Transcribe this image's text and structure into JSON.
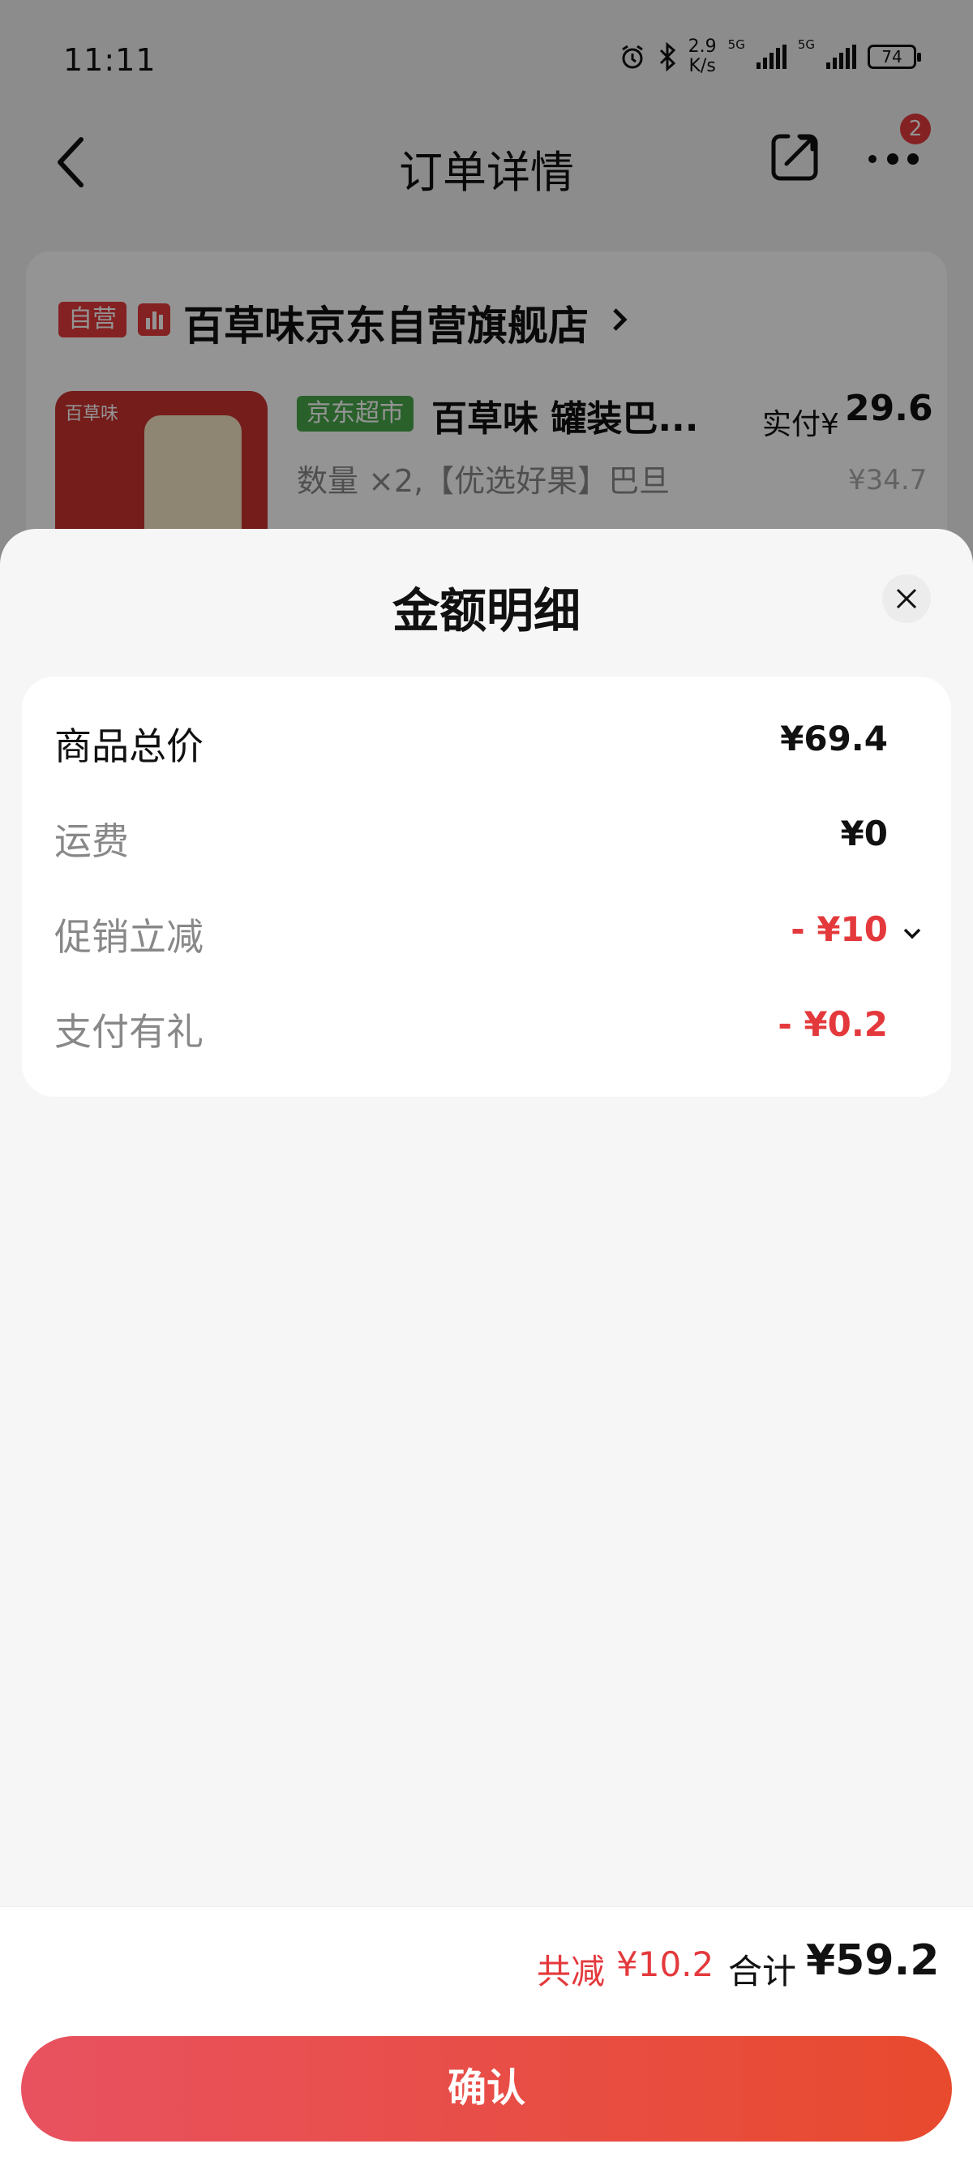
{
  "status_bar": {
    "time": "11:11",
    "net_speed_value": "2.9",
    "net_speed_unit": "K/s",
    "signal_label_1": "5G",
    "signal_label_2": "5G",
    "battery": "74"
  },
  "nav": {
    "title": "订单详情",
    "more_badge": "2"
  },
  "store": {
    "self_tag": "自营",
    "name": "百草味京东自营旗舰店",
    "product": {
      "market_tag": "京东超市",
      "name": "百草味 罐装巴...",
      "spec": "数量 ×2,【优选好果】巴旦",
      "paid_label": "实付¥",
      "paid_price": "29.6",
      "original_price": "¥34.7",
      "image_brand": "百草味"
    }
  },
  "sheet": {
    "title": "金额明细",
    "rows": [
      {
        "label": "商品总价",
        "value": "¥69.4"
      },
      {
        "label": "运费",
        "value": "¥0"
      },
      {
        "label": "促销立减",
        "value": "- ¥10"
      },
      {
        "label": "支付有礼",
        "value": "- ¥0.2"
      }
    ]
  },
  "footer": {
    "saving_label": "共减",
    "saving_value": "¥10.2",
    "total_label": "合计",
    "total_value": "¥59.2",
    "confirm_label": "确认"
  },
  "colors": {
    "accent_red": "#e4393c",
    "market_green": "#49a84a"
  }
}
